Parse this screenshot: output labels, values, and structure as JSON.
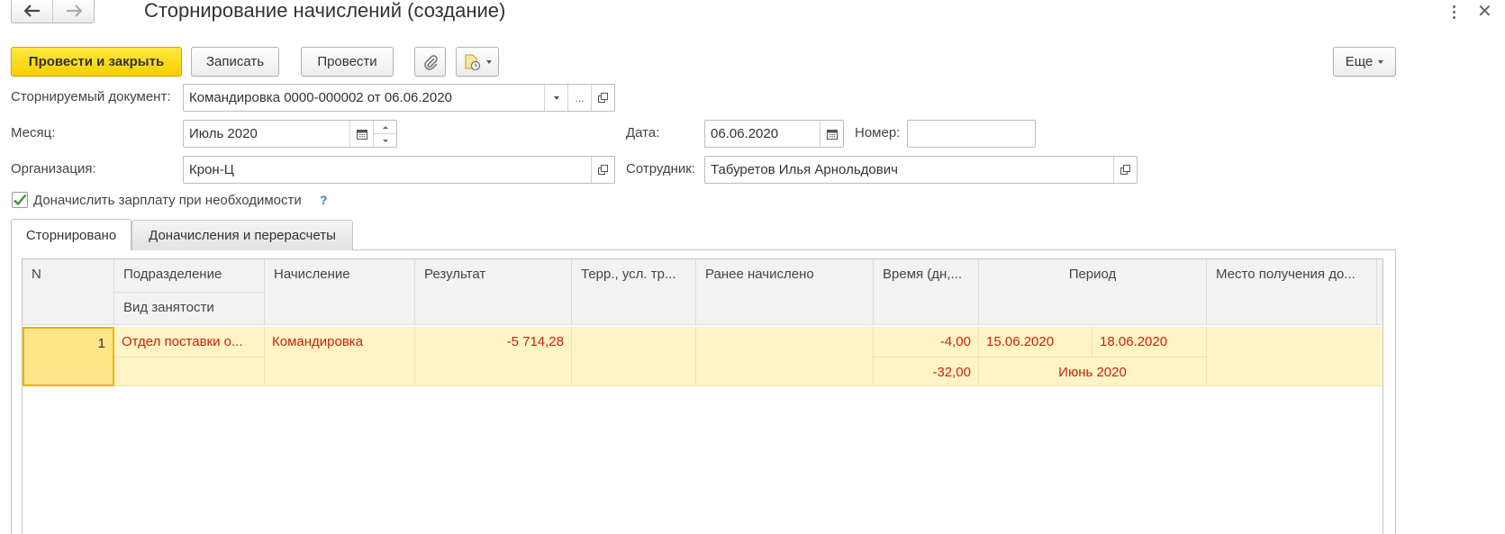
{
  "window": {
    "title": "Сторнирование начислений (создание)",
    "close_glyph": "✕"
  },
  "toolbar": {
    "post_close_label": "Провести и закрыть",
    "save_label": "Записать",
    "post_label": "Провести",
    "more_label": "Еще"
  },
  "form": {
    "storno_doc_label": "Сторнируемый документ:",
    "storno_doc_value": "Командировка 0000-000002 от 06.06.2020",
    "ellipsis": "...",
    "month_label": "Месяц:",
    "month_value": "Июль 2020",
    "date_label": "Дата:",
    "date_value": "06.06.2020",
    "number_label": "Номер:",
    "number_value": "",
    "org_label": "Организация:",
    "org_value": "Крон-Ц",
    "employee_label": "Сотрудник:",
    "employee_value": "Табуретов Илья Арнольдович",
    "recalc_checkbox_label": "Доначислить зарплату при необходимости",
    "recalc_checked": true,
    "help_glyph": "?"
  },
  "tabs": [
    {
      "label": "Сторнировано",
      "active": true
    },
    {
      "label": "Доначисления и перерасчеты",
      "active": false
    }
  ],
  "grid": {
    "columns": {
      "n": "N",
      "division": "Подразделение",
      "employment": "Вид занятости",
      "accrual": "Начисление",
      "result": "Результат",
      "terr": "Терр., усл. тр...",
      "prev_accrued": "Ранее начислено",
      "time": "Время (дн,...",
      "period": "Период",
      "place": "Место получения до..."
    },
    "rows": [
      {
        "n": "1",
        "division": "Отдел поставки о...",
        "employment": "",
        "accrual": "Командировка",
        "result": "-5 714,28",
        "terr": "",
        "prev_accrued": "",
        "time_days": "-4,00",
        "time_hours": "-32,00",
        "period_from": "15.06.2020",
        "period_to": "18.06.2020",
        "period_month": "Июнь 2020",
        "place": ""
      }
    ]
  },
  "colors": {
    "primary_button": "#f5d000",
    "row_highlight": "#fff4c6",
    "row_text": "#c8230f",
    "check_green": "#3a9a2f",
    "help_blue": "#3a7fc2"
  }
}
